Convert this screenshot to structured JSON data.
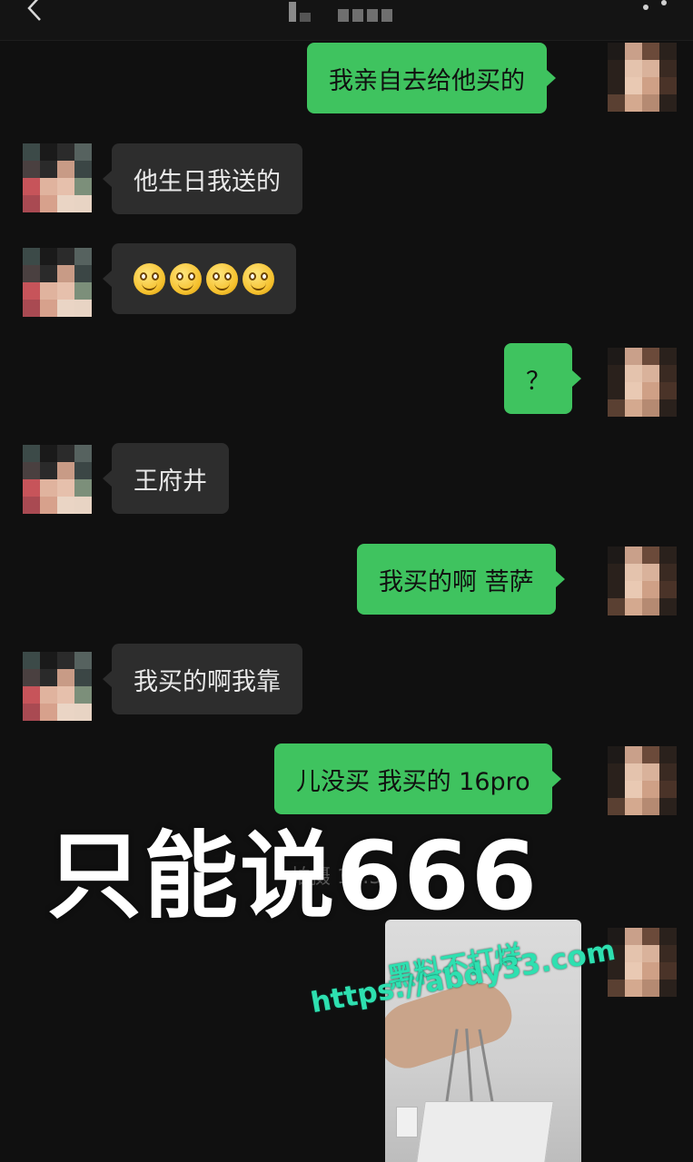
{
  "header": {
    "back_icon": "chevron-left-icon",
    "title_obscured": true,
    "more_icon": "more-dots-icon"
  },
  "messages": [
    {
      "from": "me",
      "text": "我亲自去给他买的"
    },
    {
      "from": "them",
      "text": "他生日我送的"
    },
    {
      "from": "them",
      "emoji": [
        "smiling-face",
        "smiling-face",
        "smiling-face",
        "smiling-face"
      ]
    },
    {
      "from": "me",
      "text": "？"
    },
    {
      "from": "them",
      "text": "王府井"
    },
    {
      "from": "me",
      "text": "我买的啊 菩萨"
    },
    {
      "from": "them",
      "text": "我买的啊我靠"
    },
    {
      "from": "me",
      "text": "儿没买 我买的 16pro"
    },
    {
      "from": "me",
      "image": "photo-hand-holding-gift-bag"
    }
  ],
  "overlay": {
    "caption": "只能说666",
    "obscured_timestamp": "拍摄 15:3"
  },
  "watermark": {
    "line1": "黑料不打烊",
    "line2": "https://abdy33.com"
  },
  "colors": {
    "background": "#101010",
    "my_bubble": "#3fc35f",
    "their_bubble": "#2d2d2d",
    "watermark": "#2ee0b0"
  }
}
